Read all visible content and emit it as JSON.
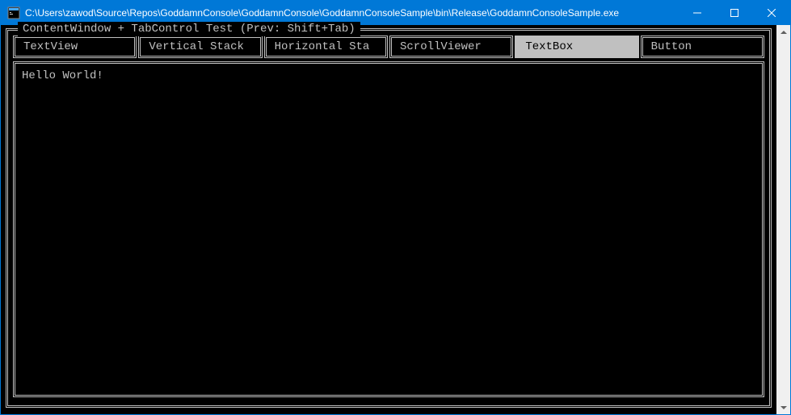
{
  "window": {
    "title": "C:\\Users\\zawod\\Source\\Repos\\GoddamnConsole\\GoddamnConsole\\GoddamnConsoleSample\\bin\\Release\\GoddamnConsoleSample.exe"
  },
  "groupbox": {
    "title": "ContentWindow + TabControl Test (Prev: Shift+Tab)"
  },
  "tabs": [
    {
      "label": "TextView",
      "active": false
    },
    {
      "label": "Vertical Stack",
      "active": false
    },
    {
      "label": "Horizontal Sta",
      "active": false
    },
    {
      "label": "ScrollViewer",
      "active": false
    },
    {
      "label": "TextBox",
      "active": true
    },
    {
      "label": "Button",
      "active": false
    }
  ],
  "content": {
    "textbox_value": "Hello World!"
  },
  "colors": {
    "accent": "#0078d7",
    "console_bg": "#000000",
    "console_fg": "#c0c0c0"
  }
}
